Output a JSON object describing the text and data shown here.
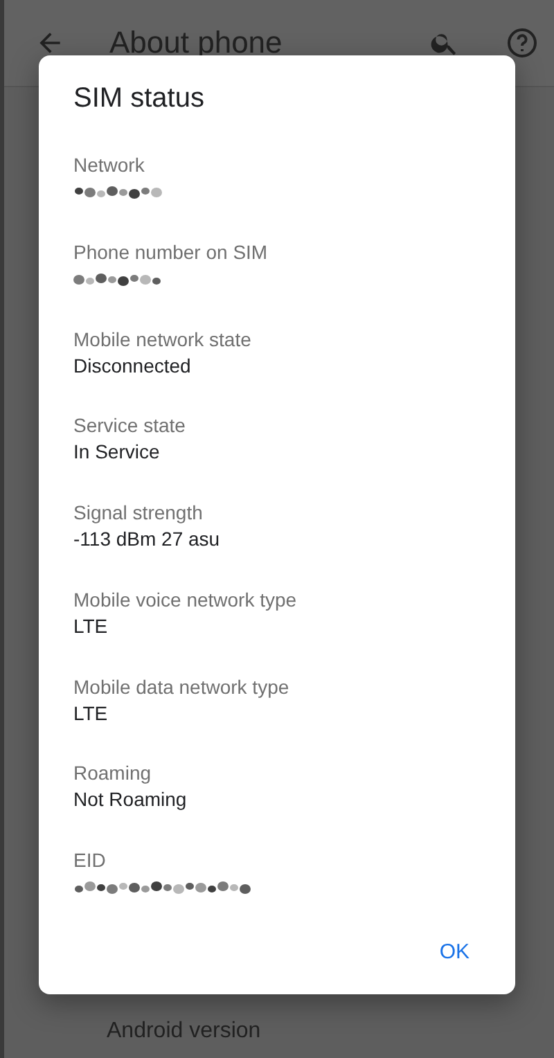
{
  "app_bar": {
    "title": "About phone"
  },
  "background_list": [
    {
      "title": "Android version"
    }
  ],
  "dialog": {
    "title": "SIM status",
    "items": [
      {
        "label": "Network",
        "kind": "redacted"
      },
      {
        "label": "Phone number on SIM",
        "kind": "redacted"
      },
      {
        "label": "Mobile network state",
        "kind": "text",
        "value": "Disconnected"
      },
      {
        "label": "Service state",
        "kind": "text",
        "value": "In Service"
      },
      {
        "label": "Signal strength",
        "kind": "text",
        "value": "-113 dBm 27 asu"
      },
      {
        "label": "Mobile voice network type",
        "kind": "text",
        "value": "LTE"
      },
      {
        "label": "Mobile data network type",
        "kind": "text",
        "value": "LTE"
      },
      {
        "label": "Roaming",
        "kind": "text",
        "value": "Not Roaming"
      },
      {
        "label": "EID",
        "kind": "redacted"
      }
    ],
    "buttons": [
      "OK"
    ]
  }
}
